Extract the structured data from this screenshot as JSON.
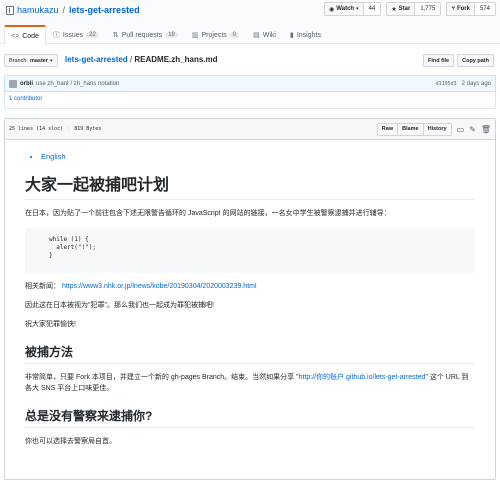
{
  "repo": {
    "owner": "hamukazu",
    "separator": "/",
    "name": "lets-get-arrested"
  },
  "actions": {
    "watch_label": "Watch",
    "watch_count": "44",
    "star_label": "Star",
    "star_count": "1,775",
    "fork_label": "Fork",
    "fork_count": "574"
  },
  "tabs": [
    {
      "label": "Code",
      "icon": "<>"
    },
    {
      "label": "Issues",
      "count": "22"
    },
    {
      "label": "Pull requests",
      "count": "19"
    },
    {
      "label": "Projects",
      "count": "0"
    },
    {
      "label": "Wiki"
    },
    {
      "label": "Insights"
    }
  ],
  "nav": {
    "branch_prefix": "Branch:",
    "branch": "master",
    "repo_link": "lets-get-arrested",
    "separator": "/",
    "file": "README.zh_hans.md",
    "find_file": "Find file",
    "copy_path": "Copy path"
  },
  "commit": {
    "author": "orbli",
    "message": "use zh_hant / zh_hans notation",
    "sha": "d1195d3",
    "time": "2 days ago"
  },
  "contributors": "1 contributor",
  "file": {
    "lines": "25 lines (14 sloc)",
    "size": "819 Bytes",
    "raw": "Raw",
    "blame": "Blame",
    "history": "History"
  },
  "readme": {
    "lang_link": "English",
    "h1": "大家一起被捕吧计划",
    "p1": "在日本，因为贴了一个前往包含下述无限警告循环的 JavaScript 的网站的链接，一名女中学生被警察逮捕并进行辅导：",
    "code": "while (1) {\n  alert(\"!\");\n}",
    "news_prefix": "相关新闻：",
    "news_link": "https://www3.nhk.or.jp/lnews/kobe/20190304/2020003239.html",
    "p3": "因此这在日本被视为\"犯罪\"。那么我们也一起成为罪犯被捕吧!",
    "p4": "祝大家犯罪愉快!",
    "h2a": "被捕方法",
    "p5_before": "非常简单，只要 Fork 本项目，并建立一个新的 gh-pages Branch。结束。当然如果分享 \"",
    "p5_link": "http://你的账户.github.io/lets-get-arrested",
    "p5_after": "\" 这个 URL 到各大 SNS 平台上口味更佳。",
    "h2b": "总是没有警察来逮捕你?",
    "p6": "你也可以选择去警察局自首。"
  }
}
